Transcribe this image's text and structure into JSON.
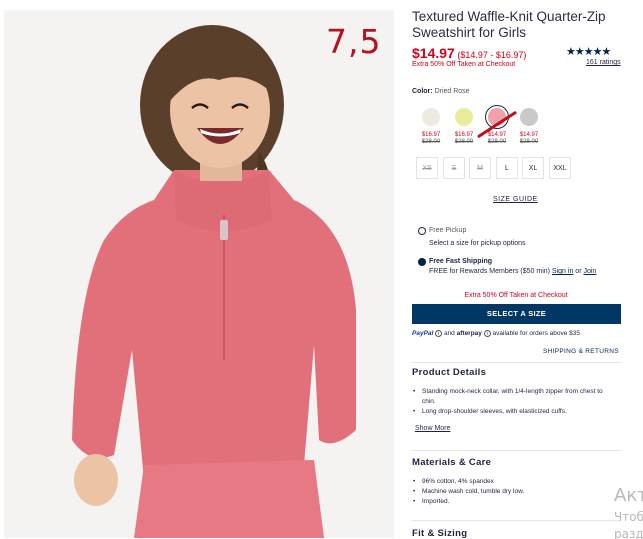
{
  "annotation": "7,5",
  "product": {
    "title": "Textured Waffle-Knit Quarter-Zip Sweatshirt for Girls",
    "price": "$14.97",
    "price_range": "($14.97 - $16.97)",
    "promo": "Extra 50% Off Taken at Checkout",
    "stars": "★★★★★",
    "ratings": "161 ratings"
  },
  "color": {
    "label": "Color:",
    "selected": "Dried Rose",
    "swatches": [
      {
        "color": "#efe9e1",
        "sale": "$16.97",
        "regular": "$28.00"
      },
      {
        "color": "#e8ea9c",
        "sale": "$16.97",
        "regular": "$28.00"
      },
      {
        "color": "#f2a0aa",
        "sale": "$14.97",
        "regular": "$28.00"
      },
      {
        "color": "#c9c9c9",
        "sale": "$14.97",
        "regular": "$28.00"
      }
    ]
  },
  "sizes": [
    "XS",
    "S",
    "M",
    "L",
    "XL",
    "XXL"
  ],
  "size_guide": "SIZE GUIDE",
  "fulfillment": {
    "pickup_title": "Free Pickup",
    "pickup_sub": "Select a size for pickup options",
    "shipping_title": "Free Fast Shipping",
    "shipping_sub_pre": "FREE for Rewards Members ($50 min)",
    "sign_in": "Sign in",
    "or": "or",
    "join": "Join"
  },
  "promo2": "Extra 50% Off Taken at Checkout",
  "cta": "SELECT A SIZE",
  "payment": {
    "paypal": "PayPal",
    "and": "and",
    "afterpay": "afterpay",
    "text": "available for orders above $35"
  },
  "shipping_returns": "SHIPPING & RETURNS",
  "details": {
    "heading": "Product Details",
    "bullets": [
      "Standing mock-neck collar, with 1/4-length zipper from chest to chin.",
      "Long drop-shoulder sleeves, with elasticized cuffs."
    ],
    "show_more": "Show More"
  },
  "materials": {
    "heading": "Materials & Care",
    "bullets": [
      "96% cotton, 4% spandex",
      "Machine wash cold, tumble dry low.",
      "Imported."
    ]
  },
  "fit": {
    "heading": "Fit & Sizing"
  },
  "watermark": {
    "line1": "Акт",
    "line2": "Чтоб",
    "line3": "разд"
  }
}
